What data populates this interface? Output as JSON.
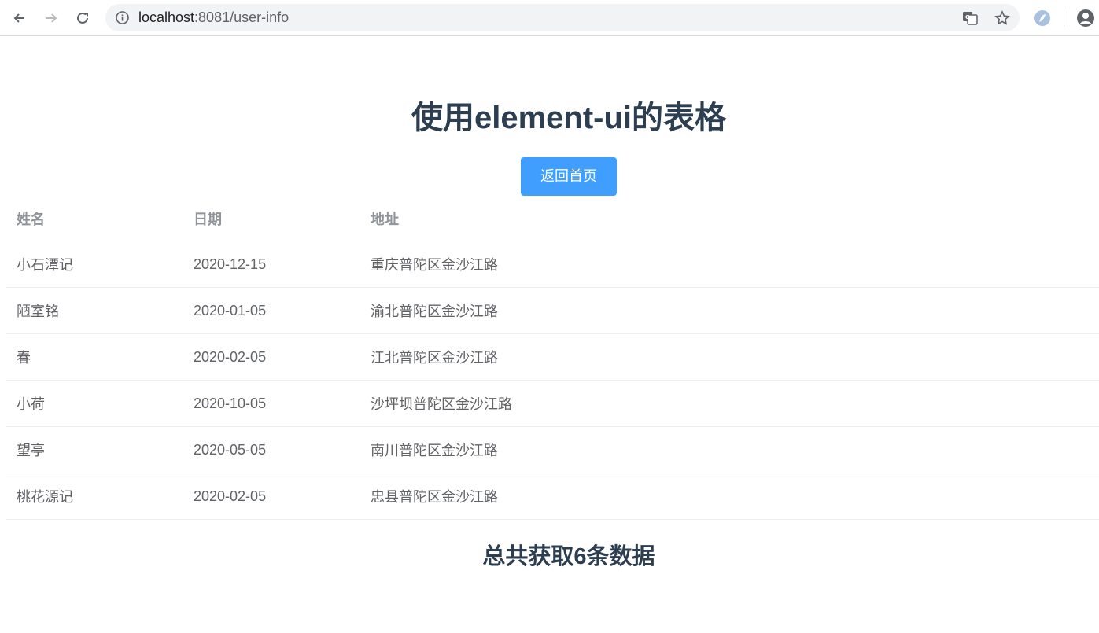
{
  "browser": {
    "url_host": "localhost",
    "url_rest": ":8081/user-info",
    "icons": [
      "back-icon",
      "forward-icon",
      "reload-icon",
      "info-icon",
      "translate-icon",
      "star-icon",
      "extension-icon",
      "profile-icon"
    ]
  },
  "page": {
    "title": "使用element-ui的表格",
    "home_button": "返回首页",
    "total": "总共获取6条数据"
  },
  "table": {
    "headers": [
      "姓名",
      "日期",
      "地址"
    ],
    "rows": [
      [
        "小石潭记",
        "2020-12-15",
        "重庆普陀区金沙江路"
      ],
      [
        "陋室铭",
        "2020-01-05",
        "渝北普陀区金沙江路"
      ],
      [
        "春",
        "2020-02-05",
        "江北普陀区金沙江路"
      ],
      [
        "小荷",
        "2020-10-05",
        "沙坪坝普陀区金沙江路"
      ],
      [
        "望亭",
        "2020-05-05",
        "南川普陀区金沙江路"
      ],
      [
        "桃花源记",
        "2020-02-05",
        "忠县普陀区金沙江路"
      ]
    ]
  },
  "colors": {
    "primary": "#409eff",
    "heading": "#2c3e50",
    "text": "#606266",
    "header_text": "#909399",
    "row_border": "#ebeef5"
  }
}
